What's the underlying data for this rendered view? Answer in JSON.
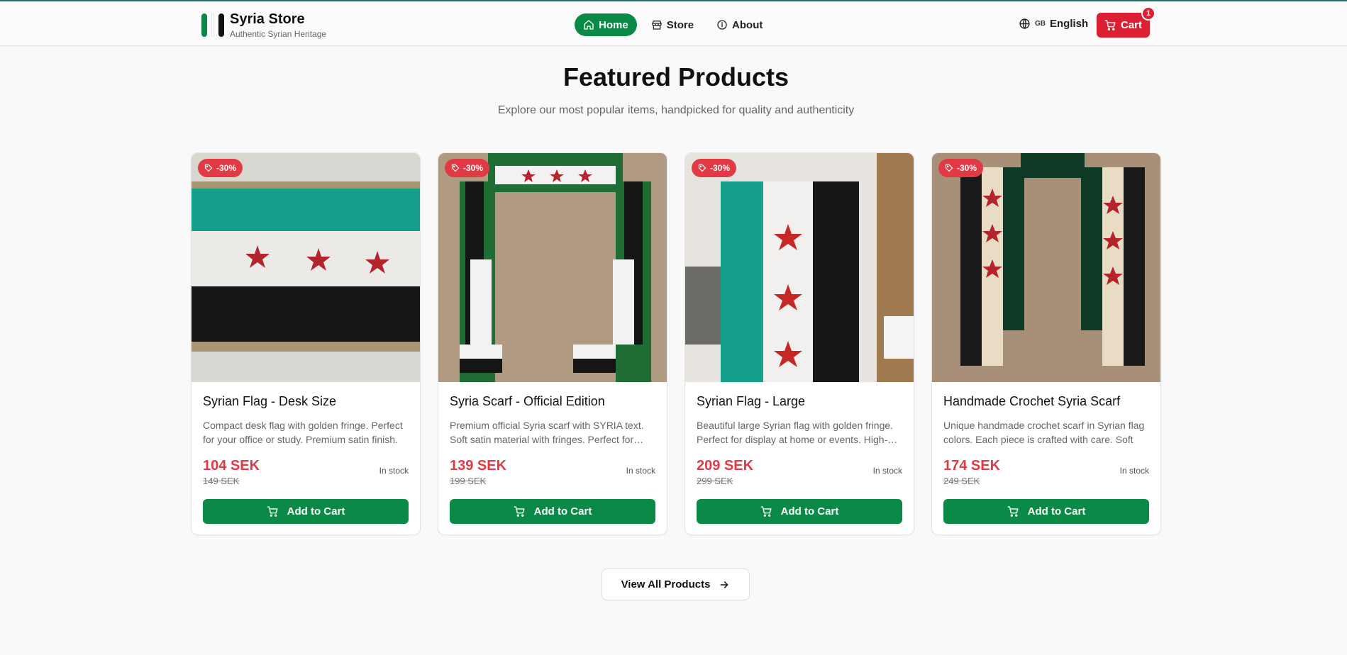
{
  "header": {
    "brand_title": "Syria Store",
    "brand_subtitle": "Authentic Syrian Heritage",
    "nav": [
      {
        "label": "Home",
        "icon": "home-icon",
        "active": true
      },
      {
        "label": "Store",
        "icon": "store-icon",
        "active": false
      },
      {
        "label": "About",
        "icon": "info-icon",
        "active": false
      }
    ],
    "language_code": "GB",
    "language": "English",
    "cart_label": "Cart",
    "cart_count": "1"
  },
  "section": {
    "title": "Featured Products",
    "subtitle": "Explore our most popular items, handpicked for quality and authenticity"
  },
  "products": [
    {
      "discount": "-30%",
      "title": "Syrian Flag - Desk Size",
      "description": "Compact desk flag with golden fringe. Perfect for your office or study. Premium satin finish.",
      "price": "104 SEK",
      "old_price": "149 SEK",
      "stock": "In stock",
      "button": "Add to Cart"
    },
    {
      "discount": "-30%",
      "title": "Syria Scarf - Official Edition",
      "description": "Premium official Syria scarf with SYRIA text. Soft satin material with fringes. Perfect for…",
      "price": "139 SEK",
      "old_price": "199 SEK",
      "stock": "In stock",
      "button": "Add to Cart"
    },
    {
      "discount": "-30%",
      "title": "Syrian Flag - Large",
      "description": "Beautiful large Syrian flag with golden fringe. Perfect for display at home or events. High-…",
      "price": "209 SEK",
      "old_price": "299 SEK",
      "stock": "In stock",
      "button": "Add to Cart"
    },
    {
      "discount": "-30%",
      "title": "Handmade Crochet Syria Scarf",
      "description": "Unique handmade crochet scarf in Syrian flag colors. Each piece is crafted with care. Soft an…",
      "price": "174 SEK",
      "old_price": "249 SEK",
      "stock": "In stock",
      "button": "Add to Cart"
    }
  ],
  "view_all_label": "View All Products",
  "colors": {
    "primary_green": "#0a8a46",
    "accent_red": "#dc1f32",
    "price_red": "#e23a44"
  }
}
